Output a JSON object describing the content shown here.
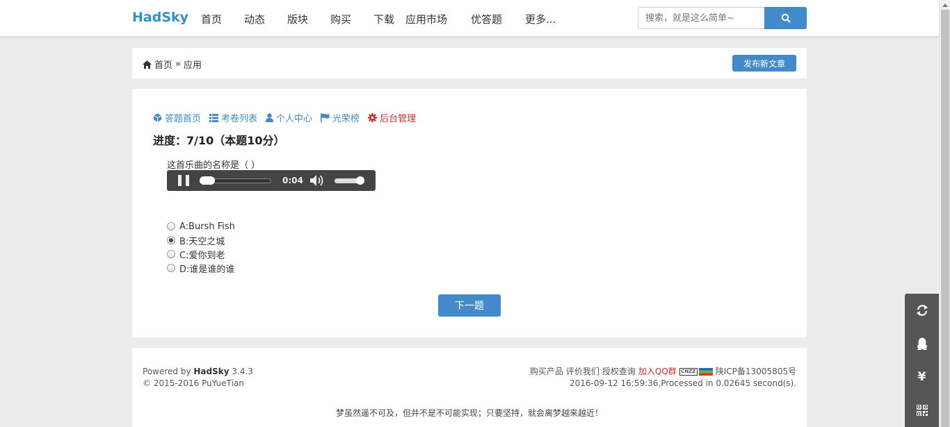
{
  "header": {
    "logo": "HadSky",
    "nav": [
      "首页",
      "动态",
      "版块",
      "购买",
      "下载",
      "应用市场",
      "优答题",
      "更多..."
    ],
    "search_placeholder": "搜索，就是这么简单~"
  },
  "breadcrumb": {
    "home": "首页",
    "separator": "»",
    "current": "应用",
    "publish_label": "发布新文章"
  },
  "quiz": {
    "tabs": [
      {
        "label": "答题首页",
        "icon": "cube-icon"
      },
      {
        "label": "考卷列表",
        "icon": "list-icon"
      },
      {
        "label": "个人中心",
        "icon": "user-icon"
      },
      {
        "label": "光荣榜",
        "icon": "flag-icon"
      },
      {
        "label": "后台管理",
        "icon": "gear-icon"
      }
    ],
    "progress": "进度：7/10（本题10分）",
    "question": "这首乐曲的名称是（      ）",
    "player": {
      "time": "0:04",
      "seek_fraction": 0.1,
      "volume_fraction": 0.85,
      "state": "playing"
    },
    "options": [
      {
        "label": "A:Bursh Fish",
        "checked": false
      },
      {
        "label": "B:天空之城",
        "checked": true
      },
      {
        "label": "C:爱你到老",
        "checked": false
      },
      {
        "label": "D:谁是谁的谁",
        "checked": false
      }
    ],
    "next_label": "下一题"
  },
  "footer": {
    "powered_prefix": "Powered by",
    "powered_name": "HadSky",
    "version": "3.4.3",
    "copyright": "© 2015-2016 PuYueTian",
    "links": [
      "购买产品",
      "评价我们",
      "授权查询"
    ],
    "qq_group": "加入QQ群",
    "cnzz": "CNZZ",
    "icp": "陕ICP备13005805号",
    "processed": "2016-09-12 16:59:36,Processed in 0.02645 second(s).",
    "motto": "梦虽然遥不可及，但并不是不可能实现；只要坚持，就会离梦越来越近！"
  },
  "side_tools": [
    "refresh-icon",
    "qq-icon",
    "yuan-icon",
    "qrcode-icon"
  ],
  "side_yuan": "¥",
  "colors": {
    "primary": "#428bca",
    "logo": "#2f8fcf",
    "danger": "#c9302c"
  }
}
